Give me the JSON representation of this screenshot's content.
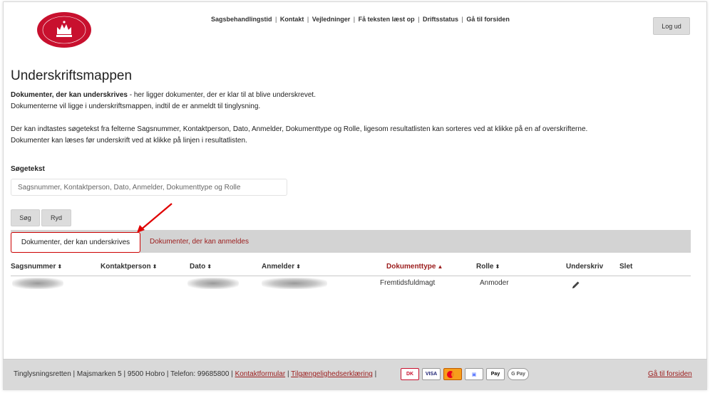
{
  "header": {
    "logo_alt": "Tinglysningsretten Danmarks Domstole",
    "nav": [
      {
        "label": "Sagsbehandlingstid"
      },
      {
        "label": "Kontakt"
      },
      {
        "label": "Vejledninger"
      },
      {
        "label": "Få teksten læst op"
      },
      {
        "label": "Driftsstatus"
      },
      {
        "label": "Gå til forsiden"
      }
    ],
    "logout_label": "Log ud"
  },
  "page": {
    "title": "Underskriftsmappen",
    "intro_bold": "Dokumenter, der kan underskrives",
    "intro_line1_rest": " - her ligger dokumenter, der er klar til at blive underskrevet.",
    "intro_line2": "Dokumenterne vil ligge i underskriftsmappen, indtil de er anmeldt til tinglysning.",
    "intro_line3": "Der kan indtastes søgetekst fra felterne Sagsnummer, Kontaktperson, Dato, Anmelder, Dokumenttype og Rolle, ligesom resultatlisten kan sorteres ved at klikke på en af overskrifterne.",
    "intro_line4": "Dokumenter kan læses før underskrift ved at klikke på linjen i resultatlisten."
  },
  "search": {
    "label": "Søgetekst",
    "value": "",
    "placeholder": "Sagsnummer, Kontaktperson, Dato, Anmelder, Dokumenttype og Rolle",
    "search_button": "Søg",
    "clear_button": "Ryd"
  },
  "tabs": [
    {
      "label": "Dokumenter, der kan underskrives",
      "active": true
    },
    {
      "label": "Dokumenter, der kan anmeldes",
      "active": false
    }
  ],
  "table": {
    "columns": [
      {
        "label": "Sagsnummer",
        "sort": "both"
      },
      {
        "label": "Kontaktperson",
        "sort": "both"
      },
      {
        "label": "Dato",
        "sort": "both"
      },
      {
        "label": "Anmelder",
        "sort": "both"
      },
      {
        "label": "Dokumenttype",
        "sort": "asc"
      },
      {
        "label": "Rolle",
        "sort": "both"
      },
      {
        "label": "Underskriv",
        "sort": "none"
      },
      {
        "label": "Slet",
        "sort": "none"
      }
    ],
    "rows": [
      {
        "dokumenttype": "Fremtidsfuldmagt",
        "rolle": "Anmoder"
      }
    ]
  },
  "footer": {
    "address": "Tinglysningsretten | Majsmarken 5 | 9500 Hobro | Telefon: 99685800 | ",
    "contact_link": "Kontaktformular",
    "separator": " | ",
    "accessibility_link": "Tilgængelighedserklæring",
    "separator2": " |",
    "home_link": "Gå til forsiden",
    "payment_icons": [
      "dankort-icon",
      "visa-icon",
      "mastercard-icon",
      "mobilepay-icon",
      "applepay-icon",
      "googlepay-icon"
    ]
  },
  "colors": {
    "accent": "#9b1c1c",
    "highlight_border": "#cc0000",
    "tabbar_bg": "#d3d3d3",
    "footer_bg": "#d9d9d9"
  }
}
